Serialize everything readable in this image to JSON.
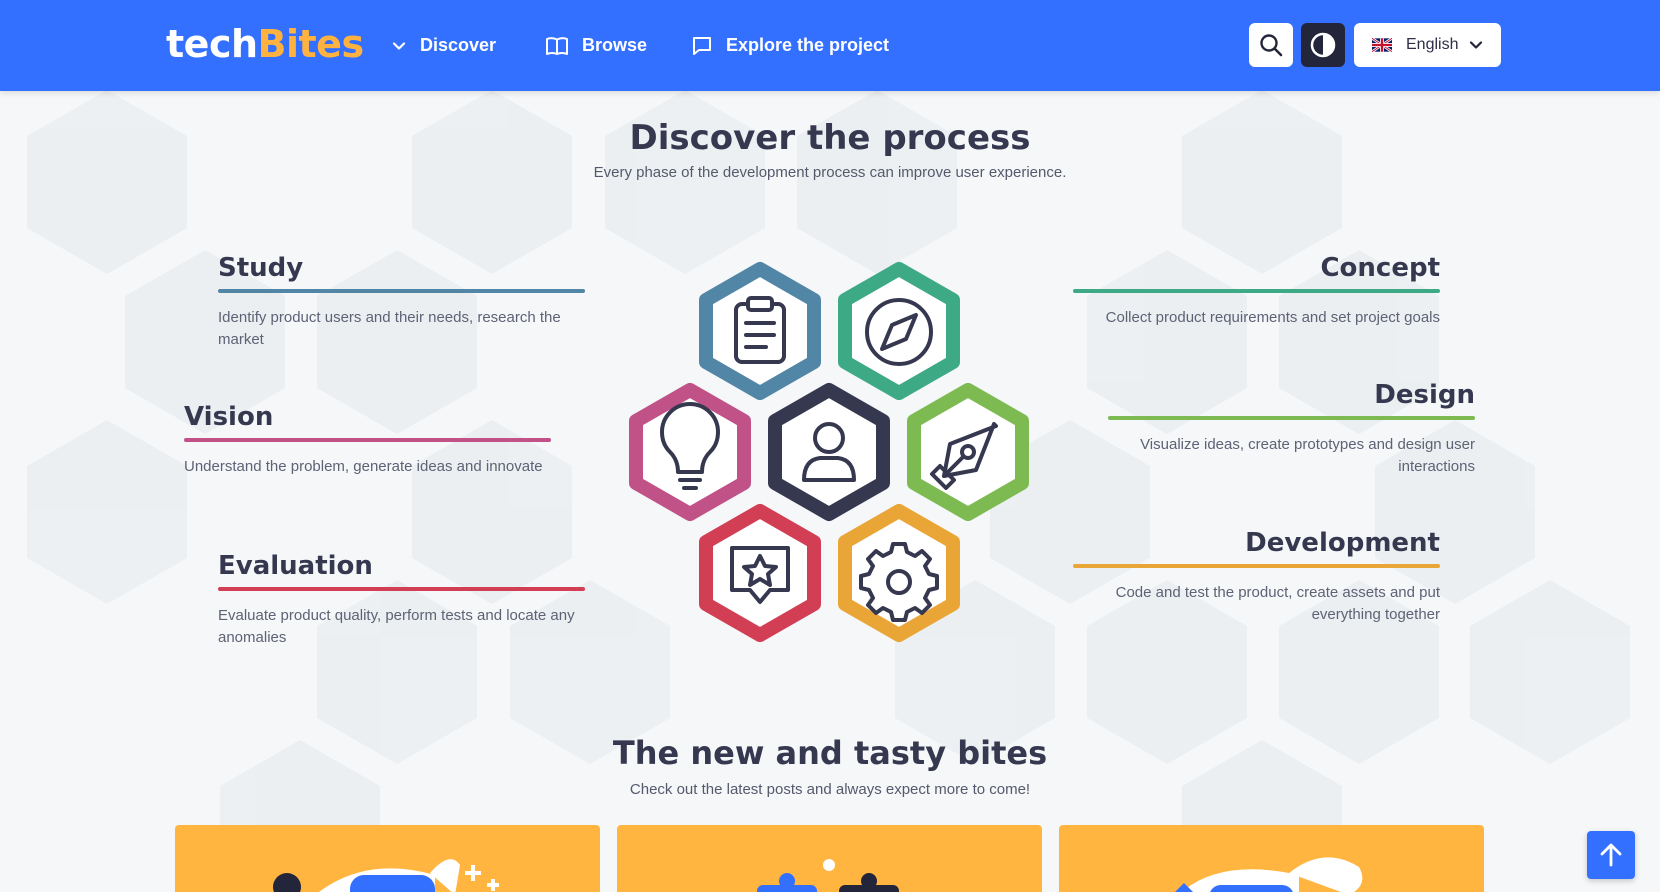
{
  "header": {
    "logo": {
      "part1": "tech",
      "part2": "Bites"
    },
    "nav": [
      {
        "label": "Discover",
        "icon": "chevron-down-icon"
      },
      {
        "label": "Browse",
        "icon": "book-icon"
      },
      {
        "label": "Explore the project",
        "icon": "chat-icon"
      }
    ],
    "search_icon": "search-icon",
    "contrast_icon": "contrast-icon",
    "language": {
      "label": "English",
      "flag": "uk-flag-icon"
    }
  },
  "process": {
    "title": "Discover the process",
    "subtitle": "Every phase of the development process can improve user experience.",
    "steps": {
      "study": {
        "title": "Study",
        "text": "Identify product users and their needs, research the market",
        "color": "#5286a6"
      },
      "vision": {
        "title": "Vision",
        "text": "Understand the problem, generate ideas and innovate",
        "color": "#c05288"
      },
      "evaluation": {
        "title": "Evaluation",
        "text": "Evaluate product quality, perform tests and locate any anomalies",
        "color": "#d23f55"
      },
      "concept": {
        "title": "Concept",
        "text": "Collect product requirements and set project goals",
        "color": "#3eaa85"
      },
      "design": {
        "title": "Design",
        "text": "Visualize ideas, create prototypes and design user interactions",
        "color": "#7dbb52"
      },
      "development": {
        "title": "Development",
        "text": "Code and test the product, create assets and put everything together",
        "color": "#eaa537"
      }
    },
    "center_color": "#363850"
  },
  "bites": {
    "title": "The new and tasty bites",
    "subtitle": "Check out the latest posts and always expect more to come!"
  },
  "colors": {
    "header": "#3370ff",
    "accent": "#ffb23f",
    "card": "#ffb53f"
  }
}
